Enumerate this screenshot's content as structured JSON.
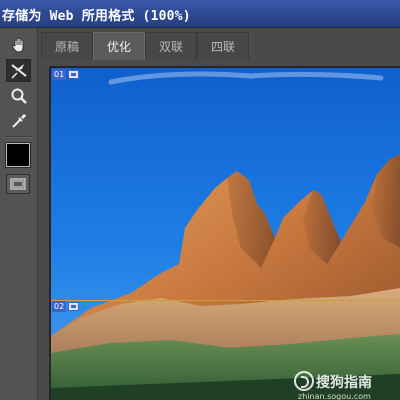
{
  "window": {
    "title": "存储为 Web 所用格式 (100%)"
  },
  "toolbar": {
    "tools": [
      {
        "name": "hand-tool",
        "icon": "hand-icon",
        "selected": false
      },
      {
        "name": "slice-select-tool",
        "icon": "slice-select-icon",
        "selected": true
      },
      {
        "name": "zoom-tool",
        "icon": "magnifier-icon",
        "selected": false
      },
      {
        "name": "eyedropper-tool",
        "icon": "eyedropper-icon",
        "selected": false
      }
    ],
    "eyedropper_color": "#000000",
    "preview_toggle_icon": "slice-visibility-icon"
  },
  "tabs": [
    {
      "label": "原稿",
      "active": false
    },
    {
      "label": "优化",
      "active": true
    },
    {
      "label": "双联",
      "active": false
    },
    {
      "label": "四联",
      "active": false
    }
  ],
  "slices": [
    {
      "number": "01"
    },
    {
      "number": "02"
    }
  ],
  "watermark": {
    "name": "搜狗指南",
    "url": "zhinan.sogou.com"
  },
  "colors": {
    "title_bar": "#2f4b96",
    "panel": "#535353",
    "slice_badge": "#3b63c9",
    "slice_line": "#c9a233"
  }
}
